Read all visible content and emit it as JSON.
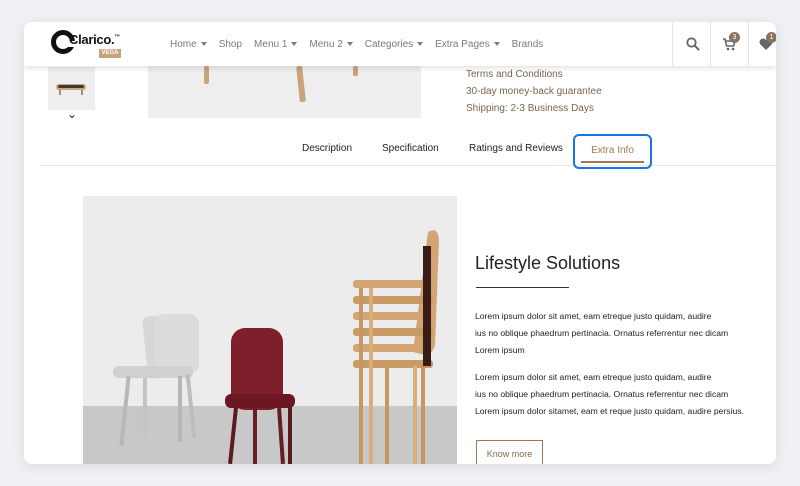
{
  "logo": {
    "name": "Clarico.",
    "tag": "VEGA",
    "tm": "™"
  },
  "nav": {
    "items": [
      {
        "label": "Home",
        "caret": true
      },
      {
        "label": "Shop",
        "caret": false
      },
      {
        "label": "Menu 1",
        "caret": true
      },
      {
        "label": "Menu 2",
        "caret": true
      },
      {
        "label": "Categories",
        "caret": true
      },
      {
        "label": "Extra Pages",
        "caret": true
      },
      {
        "label": "Brands",
        "caret": false
      }
    ]
  },
  "header_icons": {
    "search": "search-icon",
    "cart": "cart-icon",
    "wishlist": "heart-icon"
  },
  "badges": {
    "cart_count": "3",
    "wishlist_count": "1"
  },
  "product_info": {
    "terms": "Terms and Conditions",
    "guarantee": "30-day money-back guarantee",
    "shipping": "Shipping: 2-3 Business Days"
  },
  "tabs": [
    {
      "label": "Description"
    },
    {
      "label": "Specification"
    },
    {
      "label": "Ratings and Reviews"
    },
    {
      "label": "Extra Info"
    }
  ],
  "active_tab": "Extra Info",
  "extra_info": {
    "title": "Lifestyle Solutions",
    "paragraph1": [
      "Lorem ipsum dolor sit amet, eam etreque justo quidam, audire",
      "ius no oblique phaedrum pertinacia. Ornatus referrentur nec dicam",
      "Lorem ipsum"
    ],
    "paragraph2": [
      "Lorem ipsum dolor sit amet, eam etreque justo quidam, audire",
      "ius no oblique phaedrum pertinacia. Ornatus referrentur nec dicam",
      "Lorem ipsum dolor sitamet, eam et reque justo quidam, audire persius."
    ],
    "button": "Know more"
  },
  "colors": {
    "accent": "#a07850",
    "focus": "#1a73e8",
    "badge": "#8a7260"
  }
}
